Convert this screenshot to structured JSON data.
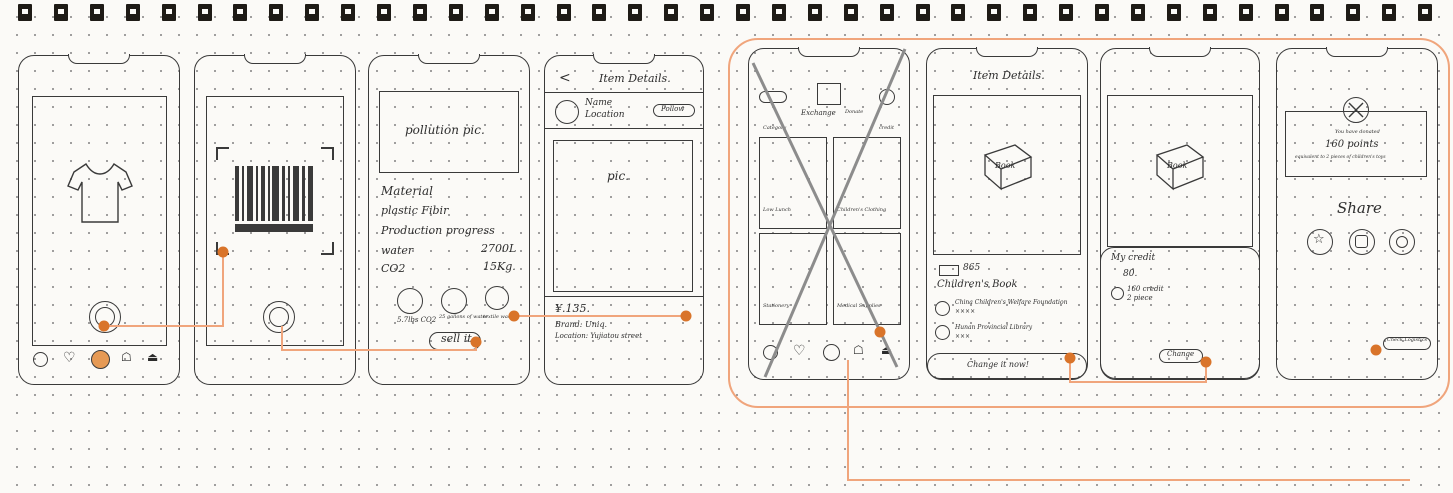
{
  "colors": {
    "flow": "#f0a57c",
    "node": "#d9742a",
    "ink": "#3a3a3a",
    "group": "#f0a57c"
  },
  "phone3": {
    "pollution": "pollution pic.",
    "material": "Material",
    "fiber": "plastic Fibir",
    "progress": "Production progress",
    "water": "water",
    "water_val": "2700L",
    "co2": "CO2",
    "co2_val": "15Kg.",
    "stat1": "5.7lbs CO2",
    "stat2": "25 gallons of water",
    "stat3": "textile waste",
    "sell": "sell it"
  },
  "phone4": {
    "title": "Item Details.",
    "back": "<",
    "name": "Name",
    "location": "Location",
    "follow": "Follow",
    "pic": "pic.",
    "price": "¥.135.",
    "brand": "Brand: Uniq.",
    "loc": "Location: Yujiatou street"
  },
  "phone5": {
    "exchange": "Exchange",
    "donate": "Donate",
    "category": "Category",
    "credit": "credit",
    "item1": "Low Lunch",
    "item2": "Children's Clothing",
    "item3": "Stationery",
    "item4": "Medical Supplies"
  },
  "phone6": {
    "title": "Item Details.",
    "book": "Book",
    "credits": "865",
    "name": "Children's Book",
    "opt1": "China Children's Welfare Foundation",
    "opt1_sub": "××××",
    "opt2": "Hunan Provincial Library",
    "opt2_sub": "×××",
    "cta": "Change it now!"
  },
  "phone7": {
    "book": "Book",
    "my_credit": "My credit",
    "credit_val": "80.",
    "cost": "160 credit",
    "pieces": "2 piece",
    "btn": "Change"
  },
  "phone8": {
    "line1": "You have donated",
    "points": "160 points",
    "line3": "equivalent to 2 pieces of children's toys",
    "share": "Share",
    "check": "Check Logistics"
  }
}
